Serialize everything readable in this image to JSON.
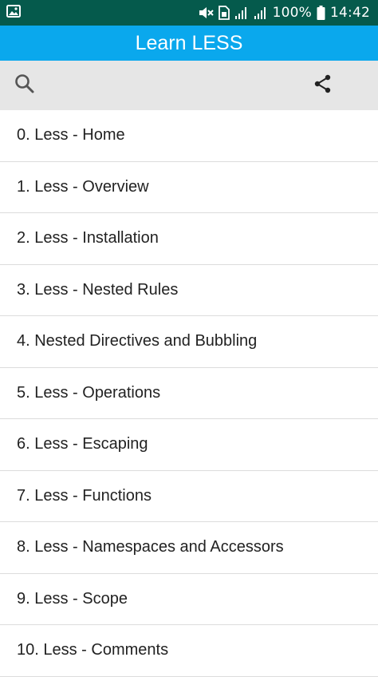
{
  "status_bar": {
    "battery_percent": "100%",
    "time": "14:42",
    "icons": [
      "image-icon",
      "mute-icon",
      "sim-icon",
      "signal-icon",
      "signal-icon",
      "battery-icon"
    ]
  },
  "app_bar": {
    "title": "Learn LESS",
    "color": "#0aa8ed"
  },
  "toolbar": {
    "icons": [
      "search-icon",
      "share-icon"
    ]
  },
  "topics": [
    "0. Less - Home",
    "1. Less - Overview",
    "2. Less - Installation",
    "3. Less - Nested Rules",
    "4. Nested Directives and Bubbling",
    "5. Less - Operations",
    "6. Less - Escaping",
    "7. Less - Functions",
    "8. Less - Namespaces and Accessors",
    "9. Less - Scope",
    "10. Less - Comments"
  ]
}
